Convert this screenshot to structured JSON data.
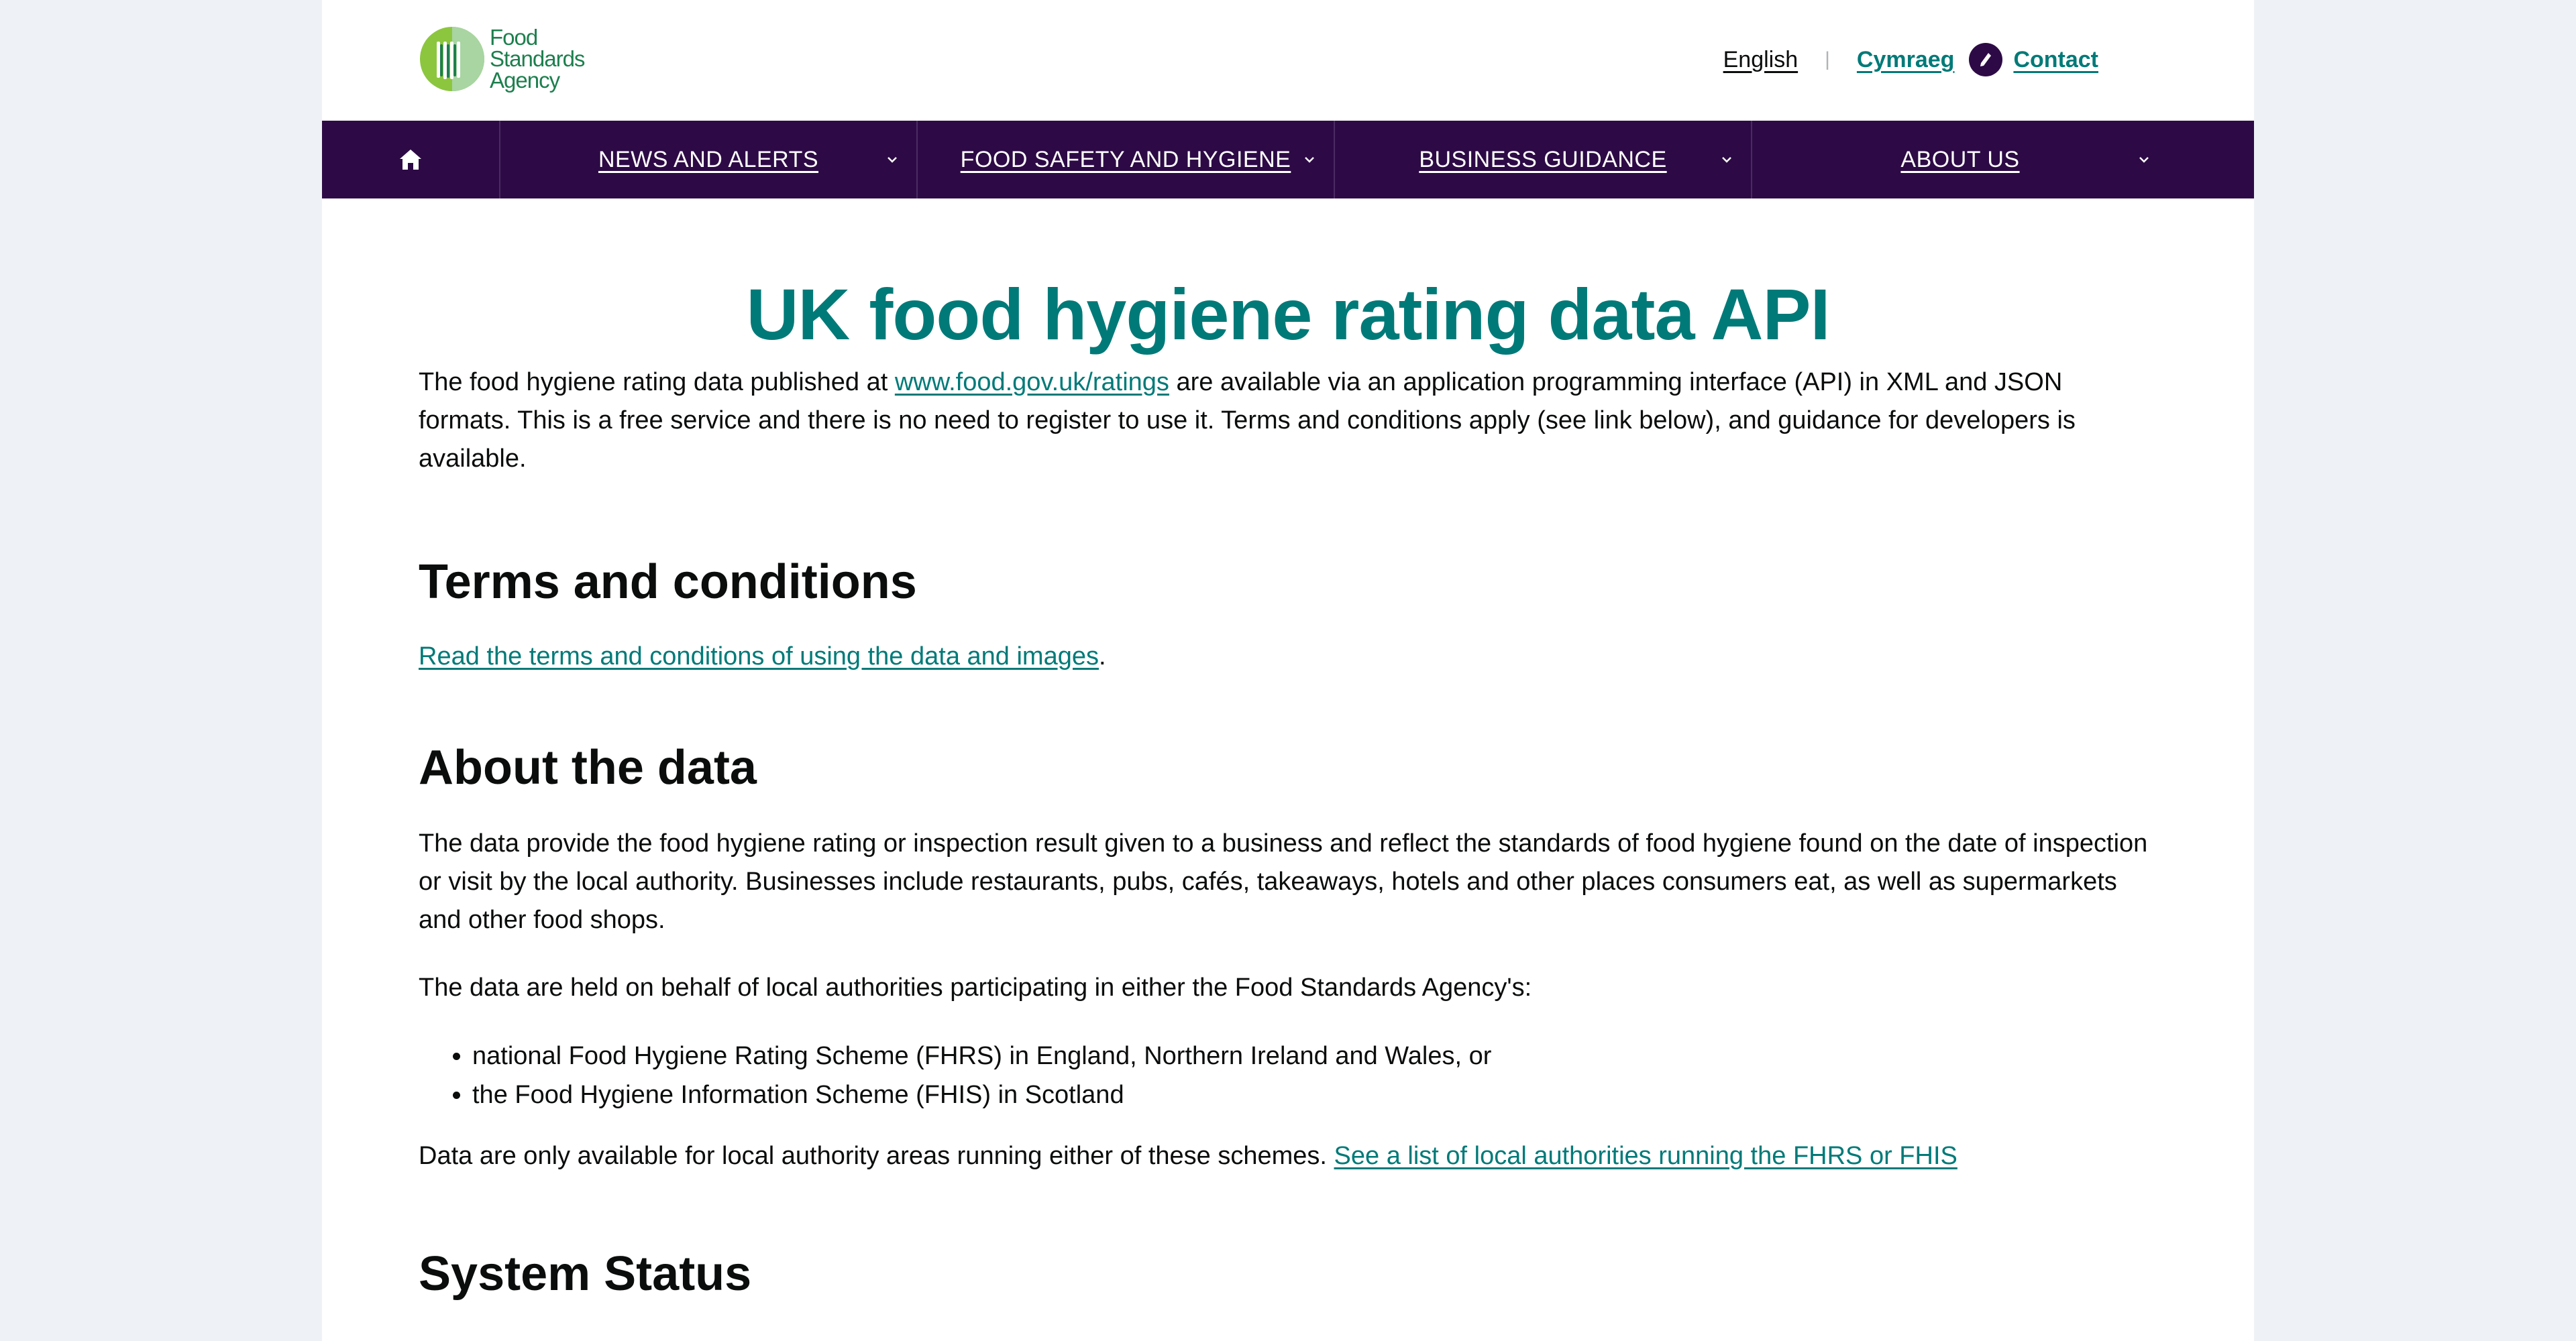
{
  "header": {
    "logo_lines": [
      "Food",
      "Standards",
      "Agency"
    ],
    "lang_english": "English",
    "lang_separator": "|",
    "lang_welsh": "Cymraeg",
    "contact": "Contact"
  },
  "nav": {
    "home_icon": "home-icon",
    "items": [
      {
        "label": "NEWS AND ALERTS"
      },
      {
        "label": "FOOD SAFETY AND HYGIENE"
      },
      {
        "label": "BUSINESS GUIDANCE"
      },
      {
        "label": "ABOUT US"
      }
    ]
  },
  "main": {
    "title": "UK food hygiene rating data API",
    "intro_before": "The food hygiene rating data published at ",
    "intro_link": "www.food.gov.uk/ratings",
    "intro_after": " are available via an application programming interface (API) in XML and JSON formats. This is a free service and there is no need to register to use it. Terms and conditions apply (see link below), and guidance for developers is available.",
    "terms_heading": "Terms and conditions",
    "terms_link": "Read the terms and conditions of using the data and images",
    "terms_period": ".",
    "about_heading": "About the data",
    "about_p1": "The data provide the food hygiene rating or inspection result given to a business and reflect the standards of food hygiene found on the date of inspection or visit by the local authority. Businesses include restaurants, pubs, cafés, takeaways, hotels and other places consumers eat, as well as supermarkets and other food shops.",
    "about_p2": "The data are held on behalf of local authorities participating in either the Food Standards Agency's:",
    "about_list": [
      "national Food Hygiene Rating Scheme (FHRS) in England, Northern Ireland and Wales, or",
      "the Food Hygiene Information Scheme (FHIS) in Scotland"
    ],
    "about_p3_text": "Data are only available for local authority areas running either of these schemes. ",
    "about_p3_link": "See a list of local authorities running the FHRS or FHIS",
    "status_heading": "System Status"
  },
  "colors": {
    "brand_teal": "#007a78",
    "nav_purple": "#2d0a45",
    "logo_green": "#1d7f4e",
    "page_bg": "#eef2f6"
  }
}
